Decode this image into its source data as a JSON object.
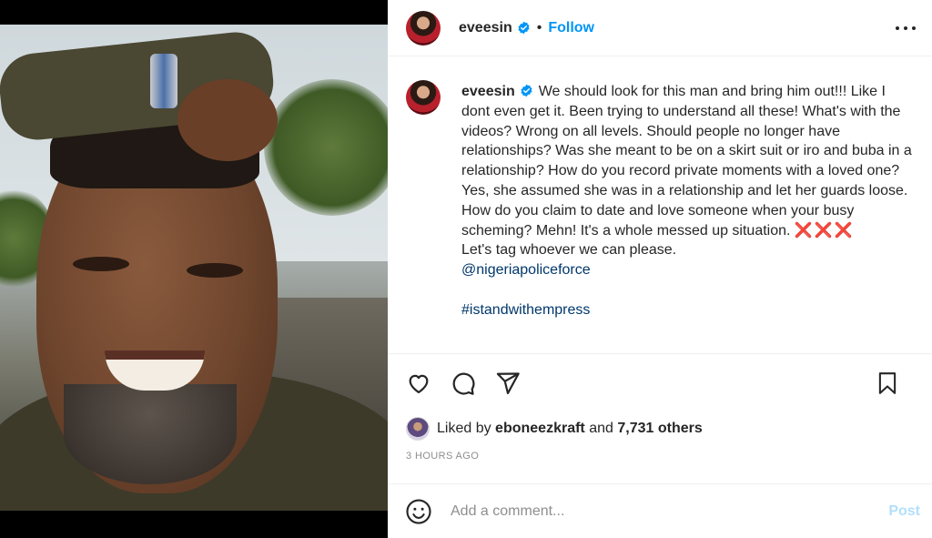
{
  "post": {
    "username": "eveesin",
    "follow_label": "Follow",
    "separator": "•",
    "caption_user": "eveesin",
    "caption_text": "We should look for this man and bring him out!!! Like I dont even get it. Been trying to understand all these! What's with the videos? Wrong on all levels. Should people no longer have relationships? Was she meant to be on a skirt suit or iro and buba in a relationship? How do you record private moments with a loved one? Yes, she assumed she was in a relationship and let her guards loose. How do you claim to date and love someone when your busy scheming? Mehn! It's a whole messed up situation.",
    "caption_marks": "❌❌❌",
    "caption_line2": "Let's tag whoever we can please.",
    "mention": "@nigeriapoliceforce",
    "hashtag": "#istandwithempress",
    "likes_prefix": "Liked by",
    "likes_user": "eboneezkraft",
    "likes_and": "and",
    "likes_count": "7,731 others",
    "timestamp": "3 HOURS AGO"
  },
  "icons": {
    "verified": "verified-badge-icon",
    "more": "more-options-icon",
    "like": "heart-icon",
    "comment": "comment-icon",
    "share": "share-icon",
    "save": "bookmark-icon",
    "emoji": "emoji-icon"
  },
  "comment": {
    "placeholder": "Add a comment...",
    "post_label": "Post"
  },
  "colors": {
    "accent": "#0095f6",
    "link": "#00376b",
    "post_disabled": "#b2dffc",
    "muted": "#8e8e8e",
    "x_marks": "#e23a62"
  }
}
